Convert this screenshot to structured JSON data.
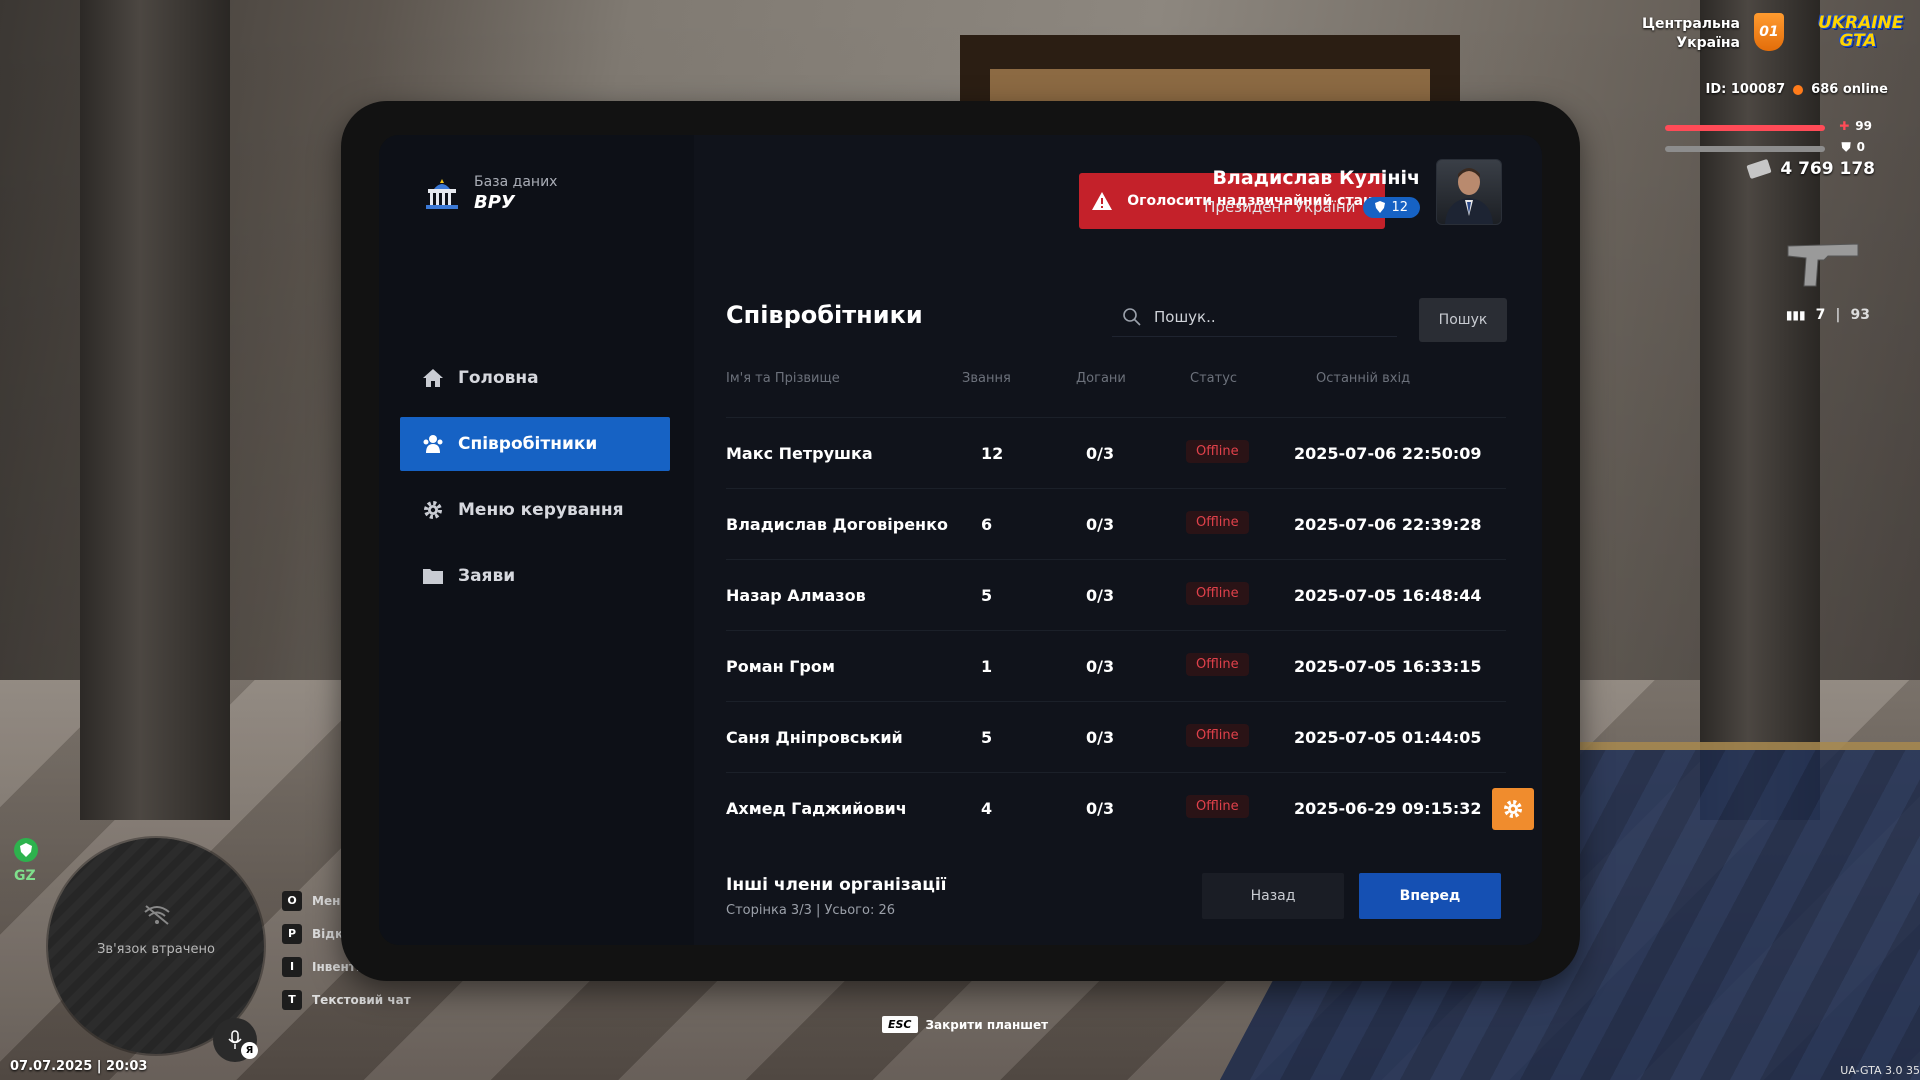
{
  "hud": {
    "region_line1": "Центральна",
    "region_line2": "Україна",
    "region_badge": "01",
    "game_logo_line1": "UKRAINE",
    "game_logo_line2": "GTA",
    "player_id": "ID: 100087",
    "online": "686 online",
    "health": "99",
    "armor": "0",
    "money": "4 769 178",
    "ammo_clip": "7",
    "ammo_sep": "|",
    "ammo_total": "93",
    "zone_label": "GZ",
    "connection_lost": "Зв'язок втрачено",
    "voice_key": "Я",
    "datetime": "07.07.2025 | 20:03",
    "version": "UA-GTA 3.0 35",
    "esc_key": "ESC",
    "esc_label": "Закрити планшет",
    "hotkeys": [
      {
        "key": "O",
        "label": "Мені"
      },
      {
        "key": "P",
        "label": "Відк"
      },
      {
        "key": "I",
        "label": "Інвент."
      },
      {
        "key": "T",
        "label": "Текстовий чат"
      }
    ],
    "colors": {
      "health": "#ff4b57",
      "armor": "#8d8d8d",
      "online_dot": "#ff7b1a"
    }
  },
  "sidebar": {
    "brand_sub": "База даних",
    "brand_title": "ВРУ",
    "items": [
      {
        "label": "Головна",
        "icon": "home-icon",
        "active": false
      },
      {
        "label": "Співробітники",
        "icon": "users-icon",
        "active": true
      },
      {
        "label": "Меню керування",
        "icon": "gear-icon",
        "active": false
      },
      {
        "label": "Заяви",
        "icon": "folder-icon",
        "active": false
      }
    ]
  },
  "header": {
    "alarm_button": "Оголосити надзвичайний стан",
    "user_name": "Владислав Кулініч",
    "user_role": "Президент України",
    "user_rank": "12",
    "colors": {
      "alarm": "#c4212a",
      "accent": "#1662c4"
    }
  },
  "main": {
    "title": "Співробітники",
    "search_placeholder": "Пошук..",
    "search_button": "Пошук",
    "columns": [
      "Ім'я та Прізвище",
      "Звання",
      "Догани",
      "Статус",
      "Останній вхід"
    ],
    "rows": [
      {
        "name": "Макс Петрушка",
        "rank": "12",
        "warnings": "0/3",
        "status": "Offline",
        "last_login": "2025-07-06 22:50:09"
      },
      {
        "name": "Владислав Договіренко",
        "rank": "6",
        "warnings": "0/3",
        "status": "Offline",
        "last_login": "2025-07-06 22:39:28"
      },
      {
        "name": "Назар Алмазов",
        "rank": "5",
        "warnings": "0/3",
        "status": "Offline",
        "last_login": "2025-07-05 16:48:44"
      },
      {
        "name": "Роман Гром",
        "rank": "1",
        "warnings": "0/3",
        "status": "Offline",
        "last_login": "2025-07-05 16:33:15"
      },
      {
        "name": "Саня Дніпровський",
        "rank": "5",
        "warnings": "0/3",
        "status": "Offline",
        "last_login": "2025-07-05 01:44:05"
      },
      {
        "name": "Ахмед Гаджийович",
        "rank": "4",
        "warnings": "0/3",
        "status": "Offline",
        "last_login": "2025-06-29 09:15:32"
      }
    ],
    "others_title": "Інші члени організації",
    "others_meta": "Сторінка 3/3 | Усього: 26",
    "back_button": "Назад",
    "next_button": "Вперед",
    "colors": {
      "status_offline": "#e0414b",
      "settings_button": "#f08c2d"
    }
  }
}
